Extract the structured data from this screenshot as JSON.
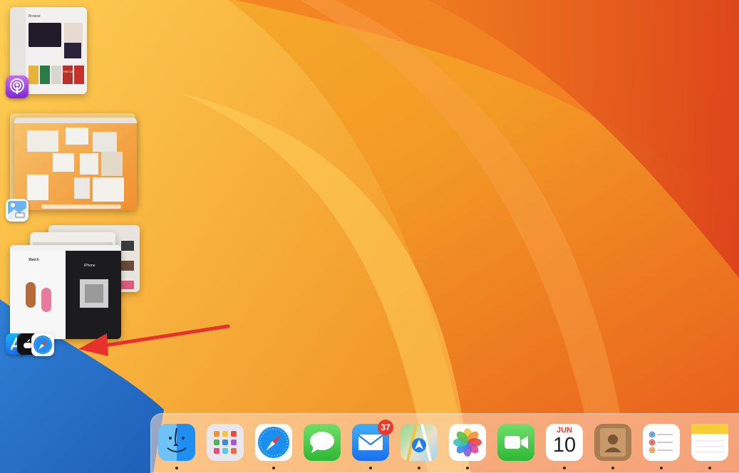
{
  "stage_manager": {
    "groups": [
      {
        "app": "Podcasts",
        "icon": "podcasts-icon",
        "window_title": "Browse",
        "content_labels": [
          "THE DAILY"
        ]
      },
      {
        "app": "Preview",
        "icon": "preview-icon"
      },
      {
        "apps": [
          "App Store",
          "Apple TV",
          "Safari"
        ],
        "icons": [
          "app-store-icon",
          "apple-tv-icon",
          "safari-icon"
        ],
        "content_labels": [
          "Watch",
          "iPhone"
        ]
      }
    ]
  },
  "annotation": {
    "arrow_color": "#e8312b"
  },
  "dock": {
    "items": [
      {
        "name": "Finder",
        "icon": "finder-icon",
        "running": true
      },
      {
        "name": "Launchpad",
        "icon": "launchpad-icon",
        "running": false
      },
      {
        "name": "Safari",
        "icon": "safari-icon",
        "running": true
      },
      {
        "name": "Messages",
        "icon": "messages-icon",
        "running": false
      },
      {
        "name": "Mail",
        "icon": "mail-icon",
        "running": true,
        "badge": "37"
      },
      {
        "name": "Maps",
        "icon": "maps-icon",
        "running": true
      },
      {
        "name": "Photos",
        "icon": "photos-icon",
        "running": true
      },
      {
        "name": "FaceTime",
        "icon": "facetime-icon",
        "running": false
      },
      {
        "name": "Calendar",
        "icon": "calendar-icon",
        "running": true,
        "month": "JUN",
        "day": "10"
      },
      {
        "name": "Contacts",
        "icon": "contacts-icon",
        "running": true
      },
      {
        "name": "Reminders",
        "icon": "reminders-icon",
        "running": true
      },
      {
        "name": "Notes",
        "icon": "notes-icon",
        "running": true
      }
    ]
  }
}
